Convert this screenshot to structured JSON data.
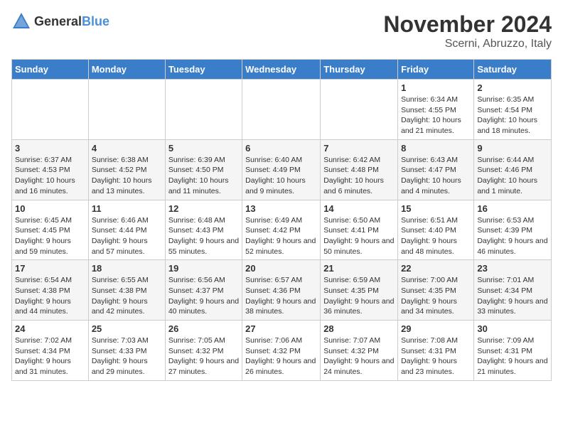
{
  "header": {
    "logo_general": "General",
    "logo_blue": "Blue",
    "month": "November 2024",
    "location": "Scerni, Abruzzo, Italy"
  },
  "days_of_week": [
    "Sunday",
    "Monday",
    "Tuesday",
    "Wednesday",
    "Thursday",
    "Friday",
    "Saturday"
  ],
  "weeks": [
    [
      {
        "day": "",
        "info": ""
      },
      {
        "day": "",
        "info": ""
      },
      {
        "day": "",
        "info": ""
      },
      {
        "day": "",
        "info": ""
      },
      {
        "day": "",
        "info": ""
      },
      {
        "day": "1",
        "info": "Sunrise: 6:34 AM\nSunset: 4:55 PM\nDaylight: 10 hours and 21 minutes."
      },
      {
        "day": "2",
        "info": "Sunrise: 6:35 AM\nSunset: 4:54 PM\nDaylight: 10 hours and 18 minutes."
      }
    ],
    [
      {
        "day": "3",
        "info": "Sunrise: 6:37 AM\nSunset: 4:53 PM\nDaylight: 10 hours and 16 minutes."
      },
      {
        "day": "4",
        "info": "Sunrise: 6:38 AM\nSunset: 4:52 PM\nDaylight: 10 hours and 13 minutes."
      },
      {
        "day": "5",
        "info": "Sunrise: 6:39 AM\nSunset: 4:50 PM\nDaylight: 10 hours and 11 minutes."
      },
      {
        "day": "6",
        "info": "Sunrise: 6:40 AM\nSunset: 4:49 PM\nDaylight: 10 hours and 9 minutes."
      },
      {
        "day": "7",
        "info": "Sunrise: 6:42 AM\nSunset: 4:48 PM\nDaylight: 10 hours and 6 minutes."
      },
      {
        "day": "8",
        "info": "Sunrise: 6:43 AM\nSunset: 4:47 PM\nDaylight: 10 hours and 4 minutes."
      },
      {
        "day": "9",
        "info": "Sunrise: 6:44 AM\nSunset: 4:46 PM\nDaylight: 10 hours and 1 minute."
      }
    ],
    [
      {
        "day": "10",
        "info": "Sunrise: 6:45 AM\nSunset: 4:45 PM\nDaylight: 9 hours and 59 minutes."
      },
      {
        "day": "11",
        "info": "Sunrise: 6:46 AM\nSunset: 4:44 PM\nDaylight: 9 hours and 57 minutes."
      },
      {
        "day": "12",
        "info": "Sunrise: 6:48 AM\nSunset: 4:43 PM\nDaylight: 9 hours and 55 minutes."
      },
      {
        "day": "13",
        "info": "Sunrise: 6:49 AM\nSunset: 4:42 PM\nDaylight: 9 hours and 52 minutes."
      },
      {
        "day": "14",
        "info": "Sunrise: 6:50 AM\nSunset: 4:41 PM\nDaylight: 9 hours and 50 minutes."
      },
      {
        "day": "15",
        "info": "Sunrise: 6:51 AM\nSunset: 4:40 PM\nDaylight: 9 hours and 48 minutes."
      },
      {
        "day": "16",
        "info": "Sunrise: 6:53 AM\nSunset: 4:39 PM\nDaylight: 9 hours and 46 minutes."
      }
    ],
    [
      {
        "day": "17",
        "info": "Sunrise: 6:54 AM\nSunset: 4:38 PM\nDaylight: 9 hours and 44 minutes."
      },
      {
        "day": "18",
        "info": "Sunrise: 6:55 AM\nSunset: 4:38 PM\nDaylight: 9 hours and 42 minutes."
      },
      {
        "day": "19",
        "info": "Sunrise: 6:56 AM\nSunset: 4:37 PM\nDaylight: 9 hours and 40 minutes."
      },
      {
        "day": "20",
        "info": "Sunrise: 6:57 AM\nSunset: 4:36 PM\nDaylight: 9 hours and 38 minutes."
      },
      {
        "day": "21",
        "info": "Sunrise: 6:59 AM\nSunset: 4:35 PM\nDaylight: 9 hours and 36 minutes."
      },
      {
        "day": "22",
        "info": "Sunrise: 7:00 AM\nSunset: 4:35 PM\nDaylight: 9 hours and 34 minutes."
      },
      {
        "day": "23",
        "info": "Sunrise: 7:01 AM\nSunset: 4:34 PM\nDaylight: 9 hours and 33 minutes."
      }
    ],
    [
      {
        "day": "24",
        "info": "Sunrise: 7:02 AM\nSunset: 4:34 PM\nDaylight: 9 hours and 31 minutes."
      },
      {
        "day": "25",
        "info": "Sunrise: 7:03 AM\nSunset: 4:33 PM\nDaylight: 9 hours and 29 minutes."
      },
      {
        "day": "26",
        "info": "Sunrise: 7:05 AM\nSunset: 4:32 PM\nDaylight: 9 hours and 27 minutes."
      },
      {
        "day": "27",
        "info": "Sunrise: 7:06 AM\nSunset: 4:32 PM\nDaylight: 9 hours and 26 minutes."
      },
      {
        "day": "28",
        "info": "Sunrise: 7:07 AM\nSunset: 4:32 PM\nDaylight: 9 hours and 24 minutes."
      },
      {
        "day": "29",
        "info": "Sunrise: 7:08 AM\nSunset: 4:31 PM\nDaylight: 9 hours and 23 minutes."
      },
      {
        "day": "30",
        "info": "Sunrise: 7:09 AM\nSunset: 4:31 PM\nDaylight: 9 hours and 21 minutes."
      }
    ]
  ]
}
